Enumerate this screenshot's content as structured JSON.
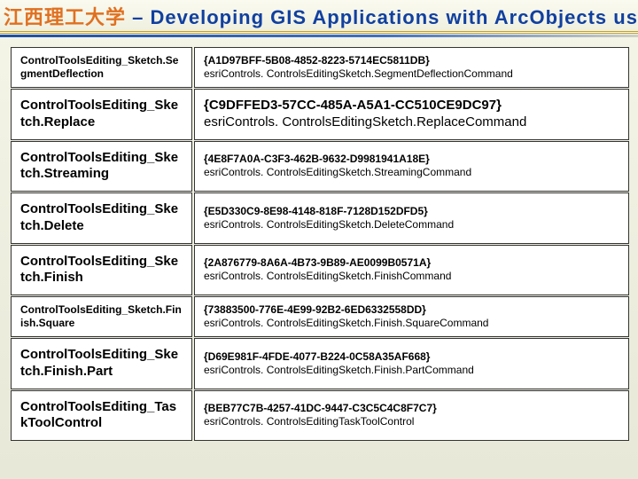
{
  "header": {
    "university_cn": "江西理工大学",
    "separator": " – ",
    "title_en": "Developing GIS Applications with ArcObjects using C#. NE"
  },
  "rows": [
    {
      "name": "ControlToolsEditing_Sketch.SegmentDeflection",
      "guid": "{A1D97BFF-5B08-4852-8223-5714EC5811DB}",
      "class": "esriControls. ControlsEditingSketch.SegmentDeflectionCommand",
      "name_size": "small",
      "desc_size": "small",
      "slim": true
    },
    {
      "name": "ControlToolsEditing_Sketch.Replace",
      "guid": "{C9DFFED3-57CC-485A-A5A1-CC510CE9DC97}",
      "class": "esriControls. ControlsEditingSketch.ReplaceCommand",
      "name_size": "mid",
      "desc_size": "mid"
    },
    {
      "name": "ControlToolsEditing_Sketch.Streaming",
      "guid": "{4E8F7A0A-C3F3-462B-9632-D9981941A18E}",
      "class": "esriControls. ControlsEditingSketch.StreamingCommand",
      "name_size": "mid",
      "desc_size": "small"
    },
    {
      "name": "ControlToolsEditing_Sketch.Delete",
      "guid": "{E5D330C9-8E98-4148-818F-7128D152DFD5}",
      "class": "esriControls. ControlsEditingSketch.DeleteCommand",
      "name_size": "mid",
      "desc_size": "small"
    },
    {
      "name": "ControlToolsEditing_Sketch.Finish",
      "guid": "{2A876779-8A6A-4B73-9B89-AE0099B0571A}",
      "class": "esriControls. ControlsEditingSketch.FinishCommand",
      "name_size": "mid",
      "desc_size": "small"
    },
    {
      "name": "ControlToolsEditing_Sketch.Finish.Square",
      "guid": "{73883500-776E-4E99-92B2-6ED6332558DD}",
      "class": "esriControls. ControlsEditingSketch.Finish.SquareCommand",
      "name_size": "small",
      "desc_size": "small",
      "slim": true
    },
    {
      "name": "ControlToolsEditing_Sketch.Finish.Part",
      "guid": "{D69E981F-4FDE-4077-B224-0C58A35AF668}",
      "class": "esriControls. ControlsEditingSketch.Finish.PartCommand",
      "name_size": "mid",
      "desc_size": "small"
    },
    {
      "name": "ControlToolsEditing_TaskToolControl",
      "guid": "{BEB77C7B-4257-41DC-9447-C3C5C4C8F7C7}",
      "class": "esriControls. ControlsEditingTaskToolControl",
      "name_size": "mid",
      "desc_size": "small"
    }
  ]
}
